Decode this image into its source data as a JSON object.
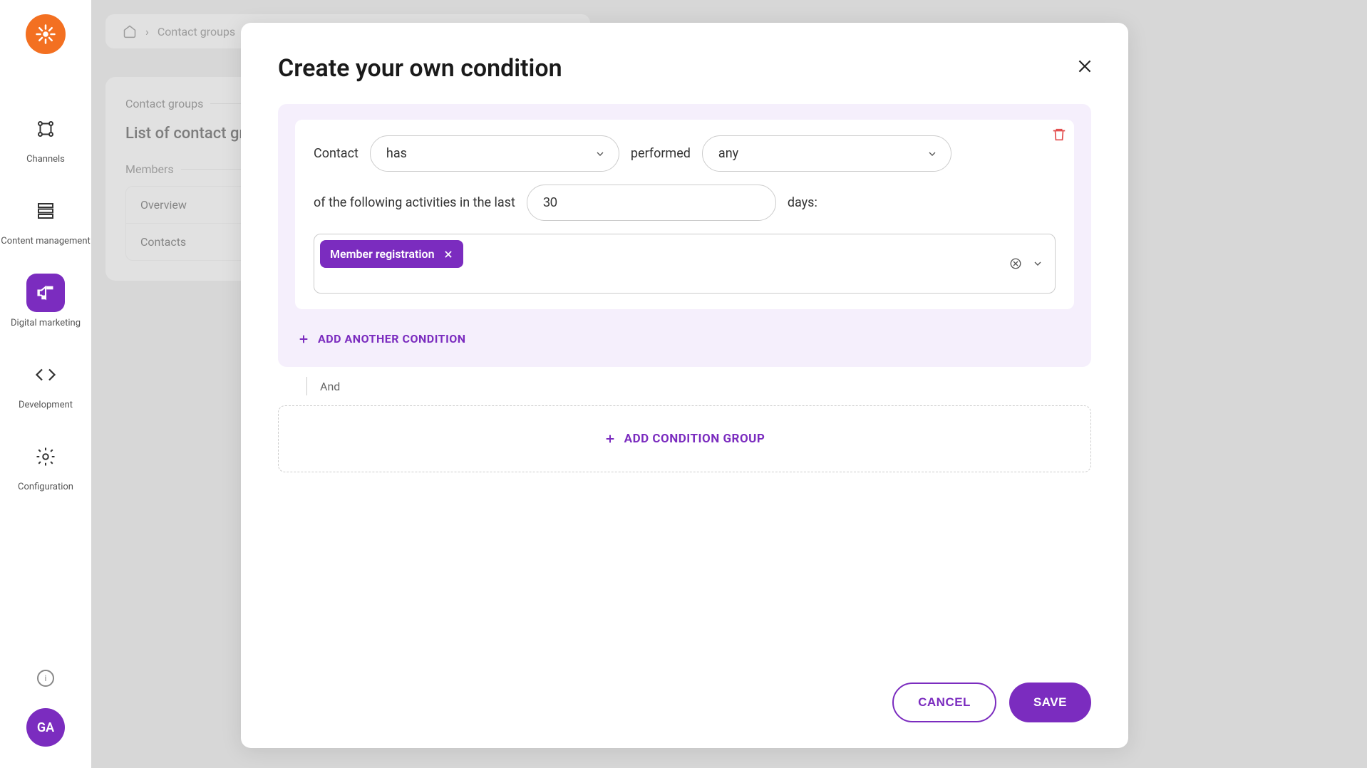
{
  "breadcrumb": {
    "home_icon": "home",
    "item1": "Contact groups"
  },
  "sidebar": {
    "items": [
      {
        "label": "Channels"
      },
      {
        "label": "Content management"
      },
      {
        "label": "Digital marketing"
      },
      {
        "label": "Development"
      },
      {
        "label": "Configuration"
      }
    ],
    "avatar_initials": "GA"
  },
  "bg_panel": {
    "header": "Contact groups",
    "title": "List of contact groups",
    "section": "Members",
    "items": [
      "Overview",
      "Contacts"
    ]
  },
  "modal": {
    "title": "Create your own condition",
    "condition": {
      "label_contact": "Contact",
      "has_value": "has",
      "label_performed": "performed",
      "any_value": "any",
      "label_prefix": "of the following activities in the last",
      "days_value": "30",
      "label_days": "days:",
      "activity_chip": "Member registration"
    },
    "add_another": "ADD ANOTHER CONDITION",
    "and_label": "And",
    "add_group": "ADD CONDITION GROUP",
    "cancel": "CANCEL",
    "save": "SAVE"
  }
}
